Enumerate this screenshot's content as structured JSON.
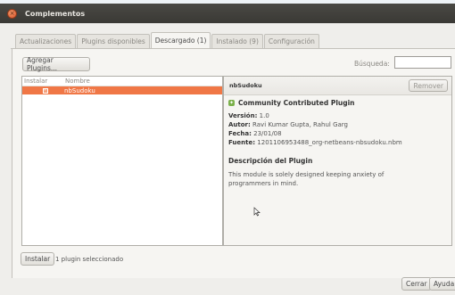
{
  "window": {
    "title": "Complementos"
  },
  "tabs": [
    {
      "label": "Actualizaciones",
      "active": false
    },
    {
      "label": "Plugins disponibles",
      "active": false
    },
    {
      "label": "Descargado (1)",
      "active": true
    },
    {
      "label": "Instalado (9)",
      "active": false
    },
    {
      "label": "Configuración",
      "active": false
    }
  ],
  "toolbar": {
    "add_plugins_label": "Agregar Plugins...",
    "search_label": "Búsqueda:",
    "search_value": ""
  },
  "list": {
    "columns": [
      "Instalar",
      "Nombre"
    ],
    "rows": [
      {
        "installed": true,
        "name": "nbSudoku",
        "selected": true
      }
    ]
  },
  "detail": {
    "name": "nbSudoku",
    "remove_label": "Remover",
    "badge": "Community Contributed Plugin",
    "version_label": "Versión:",
    "version": "1.0",
    "author_label": "Autor:",
    "author": "Ravi Kumar Gupta, Rahul Garg",
    "date_label": "Fecha:",
    "date": "23/01/08",
    "source_label": "Fuente:",
    "source": "1201106953488_org-netbeans-nbsudoku.nbm",
    "description_title": "Descripción del Plugin",
    "description": "This module is solely designed keeping anxiety of programmers in mind."
  },
  "footer": {
    "install_label": "Instalar",
    "status": "1 plugin seleccionado",
    "close_label": "Cerrar",
    "help_label": "Ayuda"
  },
  "colors": {
    "selection": "#f07746",
    "titlebar": "#3c3b37",
    "window_bg": "#efeeeb"
  }
}
